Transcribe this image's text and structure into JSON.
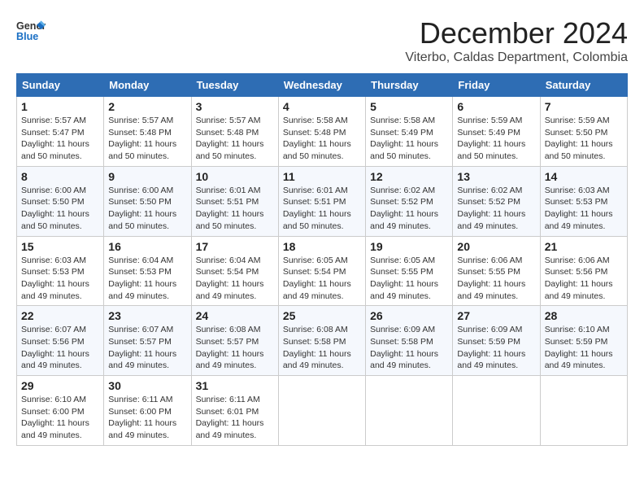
{
  "header": {
    "logo_line1": "General",
    "logo_line2": "Blue",
    "title": "December 2024",
    "subtitle": "Viterbo, Caldas Department, Colombia"
  },
  "calendar": {
    "days_of_week": [
      "Sunday",
      "Monday",
      "Tuesday",
      "Wednesday",
      "Thursday",
      "Friday",
      "Saturday"
    ],
    "weeks": [
      [
        {
          "day": "",
          "info": ""
        },
        {
          "day": "2",
          "info": "Sunrise: 5:57 AM\nSunset: 5:48 PM\nDaylight: 11 hours\nand 50 minutes."
        },
        {
          "day": "3",
          "info": "Sunrise: 5:57 AM\nSunset: 5:48 PM\nDaylight: 11 hours\nand 50 minutes."
        },
        {
          "day": "4",
          "info": "Sunrise: 5:58 AM\nSunset: 5:48 PM\nDaylight: 11 hours\nand 50 minutes."
        },
        {
          "day": "5",
          "info": "Sunrise: 5:58 AM\nSunset: 5:49 PM\nDaylight: 11 hours\nand 50 minutes."
        },
        {
          "day": "6",
          "info": "Sunrise: 5:59 AM\nSunset: 5:49 PM\nDaylight: 11 hours\nand 50 minutes."
        },
        {
          "day": "7",
          "info": "Sunrise: 5:59 AM\nSunset: 5:50 PM\nDaylight: 11 hours\nand 50 minutes."
        }
      ],
      [
        {
          "day": "1",
          "info": "Sunrise: 5:57 AM\nSunset: 5:47 PM\nDaylight: 11 hours\nand 50 minutes."
        },
        {
          "day": "9",
          "info": "Sunrise: 6:00 AM\nSunset: 5:50 PM\nDaylight: 11 hours\nand 50 minutes."
        },
        {
          "day": "10",
          "info": "Sunrise: 6:01 AM\nSunset: 5:51 PM\nDaylight: 11 hours\nand 50 minutes."
        },
        {
          "day": "11",
          "info": "Sunrise: 6:01 AM\nSunset: 5:51 PM\nDaylight: 11 hours\nand 50 minutes."
        },
        {
          "day": "12",
          "info": "Sunrise: 6:02 AM\nSunset: 5:52 PM\nDaylight: 11 hours\nand 49 minutes."
        },
        {
          "day": "13",
          "info": "Sunrise: 6:02 AM\nSunset: 5:52 PM\nDaylight: 11 hours\nand 49 minutes."
        },
        {
          "day": "14",
          "info": "Sunrise: 6:03 AM\nSunset: 5:53 PM\nDaylight: 11 hours\nand 49 minutes."
        }
      ],
      [
        {
          "day": "8",
          "info": "Sunrise: 6:00 AM\nSunset: 5:50 PM\nDaylight: 11 hours\nand 50 minutes."
        },
        {
          "day": "16",
          "info": "Sunrise: 6:04 AM\nSunset: 5:53 PM\nDaylight: 11 hours\nand 49 minutes."
        },
        {
          "day": "17",
          "info": "Sunrise: 6:04 AM\nSunset: 5:54 PM\nDaylight: 11 hours\nand 49 minutes."
        },
        {
          "day": "18",
          "info": "Sunrise: 6:05 AM\nSunset: 5:54 PM\nDaylight: 11 hours\nand 49 minutes."
        },
        {
          "day": "19",
          "info": "Sunrise: 6:05 AM\nSunset: 5:55 PM\nDaylight: 11 hours\nand 49 minutes."
        },
        {
          "day": "20",
          "info": "Sunrise: 6:06 AM\nSunset: 5:55 PM\nDaylight: 11 hours\nand 49 minutes."
        },
        {
          "day": "21",
          "info": "Sunrise: 6:06 AM\nSunset: 5:56 PM\nDaylight: 11 hours\nand 49 minutes."
        }
      ],
      [
        {
          "day": "15",
          "info": "Sunrise: 6:03 AM\nSunset: 5:53 PM\nDaylight: 11 hours\nand 49 minutes."
        },
        {
          "day": "23",
          "info": "Sunrise: 6:07 AM\nSunset: 5:57 PM\nDaylight: 11 hours\nand 49 minutes."
        },
        {
          "day": "24",
          "info": "Sunrise: 6:08 AM\nSunset: 5:57 PM\nDaylight: 11 hours\nand 49 minutes."
        },
        {
          "day": "25",
          "info": "Sunrise: 6:08 AM\nSunset: 5:58 PM\nDaylight: 11 hours\nand 49 minutes."
        },
        {
          "day": "26",
          "info": "Sunrise: 6:09 AM\nSunset: 5:58 PM\nDaylight: 11 hours\nand 49 minutes."
        },
        {
          "day": "27",
          "info": "Sunrise: 6:09 AM\nSunset: 5:59 PM\nDaylight: 11 hours\nand 49 minutes."
        },
        {
          "day": "28",
          "info": "Sunrise: 6:10 AM\nSunset: 5:59 PM\nDaylight: 11 hours\nand 49 minutes."
        }
      ],
      [
        {
          "day": "22",
          "info": "Sunrise: 6:07 AM\nSunset: 5:56 PM\nDaylight: 11 hours\nand 49 minutes."
        },
        {
          "day": "30",
          "info": "Sunrise: 6:11 AM\nSunset: 6:00 PM\nDaylight: 11 hours\nand 49 minutes."
        },
        {
          "day": "31",
          "info": "Sunrise: 6:11 AM\nSunset: 6:01 PM\nDaylight: 11 hours\nand 49 minutes."
        },
        {
          "day": "",
          "info": ""
        },
        {
          "day": "",
          "info": ""
        },
        {
          "day": "",
          "info": ""
        },
        {
          "day": "",
          "info": ""
        }
      ],
      [
        {
          "day": "29",
          "info": "Sunrise: 6:10 AM\nSunset: 6:00 PM\nDaylight: 11 hours\nand 49 minutes."
        },
        {
          "day": "",
          "info": ""
        },
        {
          "day": "",
          "info": ""
        },
        {
          "day": "",
          "info": ""
        },
        {
          "day": "",
          "info": ""
        },
        {
          "day": "",
          "info": ""
        },
        {
          "day": "",
          "info": ""
        }
      ]
    ]
  }
}
